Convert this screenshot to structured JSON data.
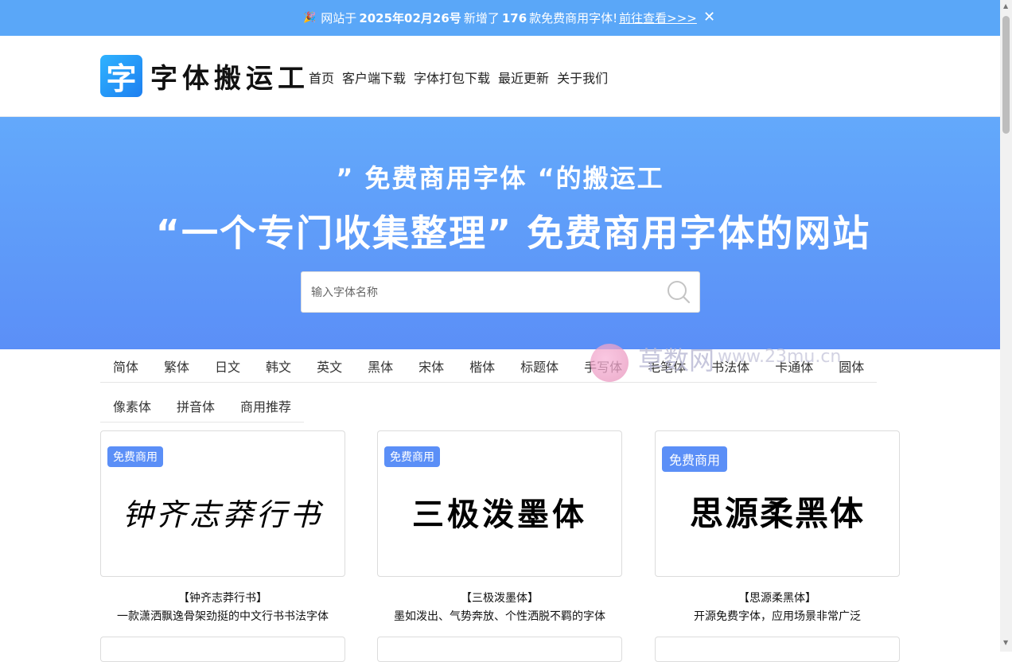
{
  "notice": {
    "icon": "party-popper-icon",
    "text_before": "网站于",
    "date": "2025年02月26号",
    "text_mid": "新增了",
    "count": "176",
    "text_after": "款免费商用字体!",
    "link": "前往查看>>>",
    "close": "✕"
  },
  "header": {
    "logo_icon_char": "字",
    "logo_text": "字体搬运工",
    "nav": [
      "首页",
      "客户端下载",
      "字体打包下载",
      "最近更新",
      "关于我们"
    ]
  },
  "hero": {
    "line1": "” 免费商用字体 “的搬运工",
    "line2": "“一个专门收集整理” 免费商用字体的网站",
    "search_placeholder": "输入字体名称"
  },
  "categories_row1": [
    "简体",
    "繁体",
    "日文",
    "韩文",
    "英文",
    "黑体",
    "宋体",
    "楷体",
    "标题体",
    "手写体",
    "毛笔体",
    "书法体",
    "卡通体",
    "圆体"
  ],
  "categories_row2": [
    "像素体",
    "拼音体",
    "商用推荐"
  ],
  "watermark": {
    "text": "草数网",
    "url": "www.23mu.cn"
  },
  "cards": [
    {
      "badge": "免费商用",
      "preview": "钟齐志莽行书",
      "title": "【钟齐志莽行书】",
      "desc": "一款潇洒飘逸骨架劲挺的中文行书书法字体"
    },
    {
      "badge": "免费商用",
      "preview": "三极泼墨体",
      "title": "【三极泼墨体】",
      "desc": "墨如泼出、气势奔放、个性洒脱不羁的字体"
    },
    {
      "badge": "免费商用",
      "preview": "思源柔黑体",
      "title": "【思源柔黑体】",
      "desc": "开源免费字体，应用场景非常广泛"
    }
  ],
  "colors": {
    "accent": "#5b8ff7",
    "notice_bg": "#5aa7f8",
    "hero_top": "#63a9fb",
    "hero_bottom": "#5b8ff7"
  }
}
